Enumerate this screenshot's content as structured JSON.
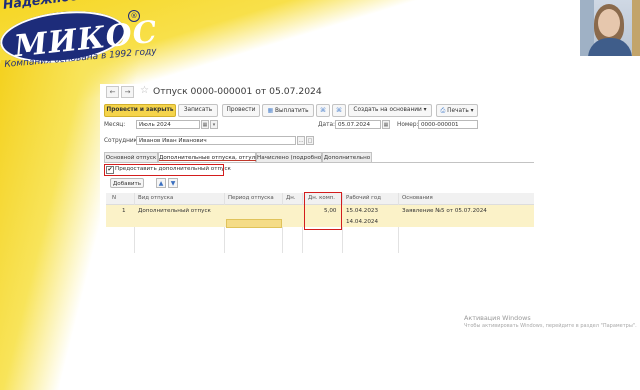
{
  "brand": {
    "slogan": "Надежность и стабильность",
    "reg_mark": "®",
    "logo_text": "МИКОС",
    "tagline": "Компания основана в 1992 году"
  },
  "document": {
    "nav_back": "←",
    "nav_forward": "→",
    "star": "☆",
    "title": "Отпуск 0000-000001 от 05.07.2024"
  },
  "toolbar": {
    "post_close": "Провести и закрыть",
    "save": "Записать",
    "post": "Провести",
    "pay_icon": "▦",
    "pay": "Выплатить",
    "attach_icon": "⌘",
    "create_based": "Создать на основании",
    "print_icon": "⎙",
    "print": "Печать",
    "dropdown_arrow": "▾"
  },
  "fields": {
    "month_label": "Месяц:",
    "month_value": "Июль 2024",
    "date_label": "Дата:",
    "date_value": "05.07.2024",
    "number_label": "Номер:",
    "number_value": "0000-000001",
    "employee_label": "Сотрудник:",
    "employee_value": "Иванов Иван Иванович",
    "calendar_icon": "▦",
    "select_icon": "…",
    "dropdown_icon": "▾",
    "open_icon": "□"
  },
  "tabs": [
    {
      "label": "Основной отпуск",
      "active": false
    },
    {
      "label": "Дополнительные отпуска, отгулы",
      "active": true
    },
    {
      "label": "Начислено (подробно)",
      "active": false
    },
    {
      "label": "Дополнительно",
      "active": false
    }
  ],
  "checkbox": {
    "label": "Предоставить дополнительный отпуск",
    "checked": true,
    "mark": "✔"
  },
  "table_toolbar": {
    "add_label": "Добавить",
    "up_arrow": "▲",
    "down_arrow": "▼"
  },
  "table": {
    "headers": {
      "n": "N",
      "kind": "Вид отпуска",
      "period": "Период отпуска",
      "days": "Дн.",
      "days_comp": "Дн. комп.",
      "work_year": "Рабочий год",
      "basis": "Основания"
    },
    "rows": [
      {
        "n": "1",
        "kind": "Дополнительный отпуск",
        "days_comp": "5,00",
        "work_year_from": "15.04.2023",
        "work_year_to": "14.04.2024",
        "basis": "Заявление №5 от 05.07.2024"
      }
    ]
  },
  "windows_activation": {
    "title": "Активация Windows",
    "subtitle": "Чтобы активировать Windows, перейдите в раздел \"Параметры\"."
  }
}
